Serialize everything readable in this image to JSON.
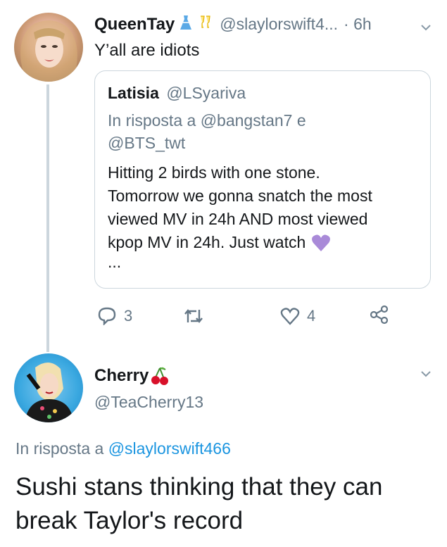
{
  "tweet1": {
    "display_name": "QueenTay",
    "name_emojis": [
      "dress-emoji",
      "champagne-emoji"
    ],
    "handle": "@slaylorswift4...",
    "time": "· 6h",
    "text": "Y’all are idiots"
  },
  "quoted": {
    "display_name": "Latisia",
    "handle": "@LSyariva",
    "reply_prefix": "In risposta a",
    "reply_to_1": "@bangstan7",
    "reply_join": "e",
    "reply_to_2": "@BTS_twt",
    "text_lines": [
      "Hitting 2 birds with one stone.",
      "Tomorrow we gonna snatch the most",
      "viewed MV in 24h AND most viewed",
      "kpop MV in 24h. Just watch"
    ],
    "emoji": "purple-heart",
    "more": "..."
  },
  "actions": {
    "reply_count": "3",
    "retweet_count": "",
    "like_count": "4"
  },
  "tweet2": {
    "display_name": "Cherry",
    "name_emoji": "cherries-emoji",
    "handle": "@TeaCherry13",
    "reply_prefix": "In risposta a",
    "reply_to": "@slaylorswift466",
    "text_line1": "Sushi stans thinking that they can",
    "text_line2": "break Taylor's record"
  },
  "colors": {
    "link": "#1b95e0",
    "secondary": "#657786",
    "border": "#ccd6dd",
    "purple_heart": "#a98ad8"
  }
}
